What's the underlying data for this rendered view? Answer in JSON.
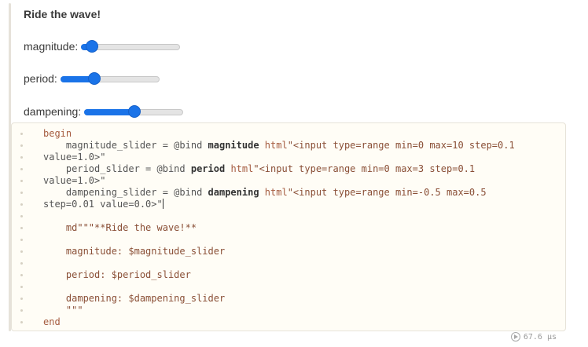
{
  "output": {
    "title": "Ride the wave!",
    "sliders": [
      {
        "label": "magnitude:",
        "value": 1.0,
        "min": 0,
        "max": 10
      },
      {
        "label": "period:",
        "value": 1.0,
        "min": 0,
        "max": 3
      },
      {
        "label": "dampening:",
        "value": 0.0,
        "min": -0.5,
        "max": 0.5
      }
    ]
  },
  "code": {
    "lines": [
      "begin",
      "    magnitude_slider = @bind magnitude html\"<input type=range min=0 max=10 step=0.1",
      "value=1.0>\"",
      "    period_slider = @bind period html\"<input type=range min=0 max=3 step=0.1",
      "value=1.0>\"",
      "    dampening_slider = @bind dampening html\"<input type=range min=-0.5 max=0.5",
      "step=0.01 value=0.0>\"",
      "",
      "    md\"\"\"**Ride the wave!**",
      "",
      "    magnitude: $magnitude_slider",
      "",
      "    period: $period_slider",
      "",
      "    dampening: $dampening_slider",
      "    \"\"\"",
      "end"
    ]
  },
  "timing": {
    "value": "67.6 µs"
  },
  "colors": {
    "accent": "#1a73e8",
    "code_bg": "#fffdf6"
  }
}
